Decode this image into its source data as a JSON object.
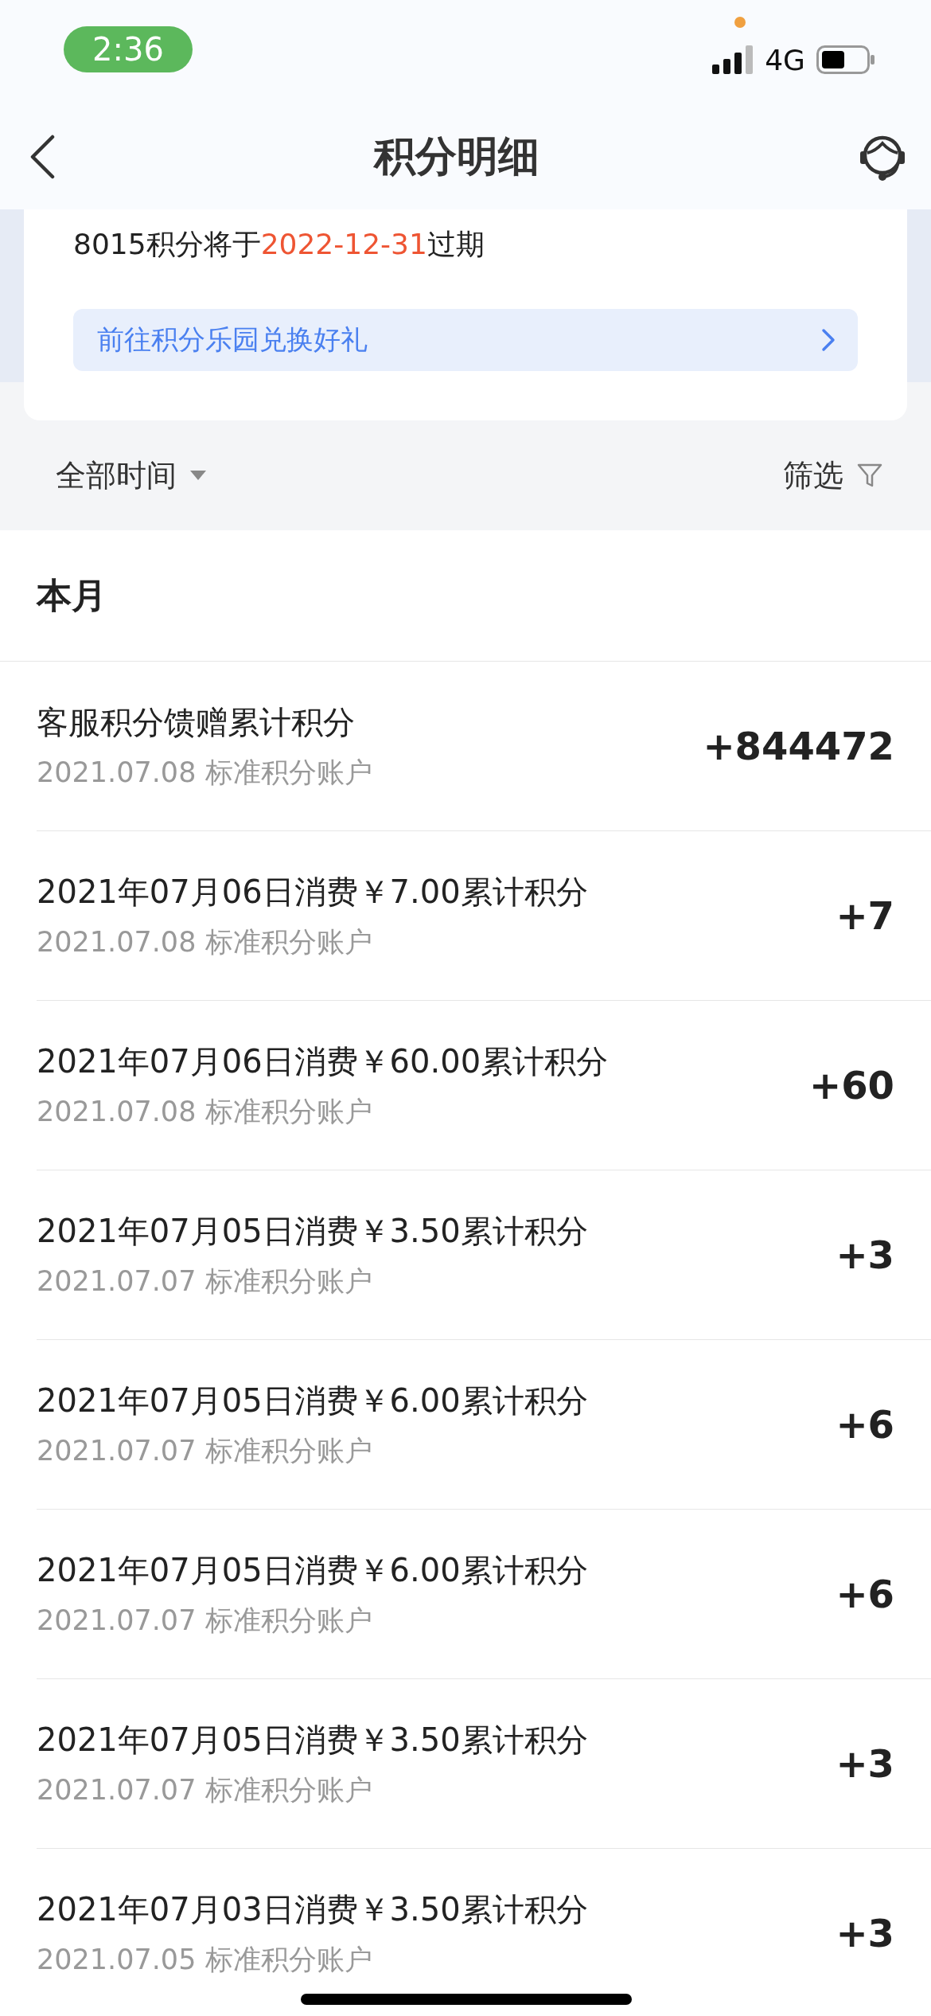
{
  "status_bar": {
    "time": "2:36",
    "network": "4G"
  },
  "nav": {
    "title": "积分明细"
  },
  "expiry": {
    "points": "8015积分将于",
    "date": "2022-12-31",
    "suffix": "过期"
  },
  "promo": {
    "label": "前往积分乐园兑换好礼"
  },
  "filters": {
    "period": "全部时间",
    "filter": "筛选"
  },
  "section": {
    "title": "本月"
  },
  "records": [
    {
      "title": "客服积分馈赠累计积分",
      "subtitle": "2021.07.08 标准积分账户",
      "amount": "+844472"
    },
    {
      "title": "2021年07月06日消费￥7.00累计积分",
      "subtitle": "2021.07.08 标准积分账户",
      "amount": "+7"
    },
    {
      "title": "2021年07月06日消费￥60.00累计积分",
      "subtitle": "2021.07.08 标准积分账户",
      "amount": "+60"
    },
    {
      "title": "2021年07月05日消费￥3.50累计积分",
      "subtitle": "2021.07.07 标准积分账户",
      "amount": "+3"
    },
    {
      "title": "2021年07月05日消费￥6.00累计积分",
      "subtitle": "2021.07.07 标准积分账户",
      "amount": "+6"
    },
    {
      "title": "2021年07月05日消费￥6.00累计积分",
      "subtitle": "2021.07.07 标准积分账户",
      "amount": "+6"
    },
    {
      "title": "2021年07月05日消费￥3.50累计积分",
      "subtitle": "2021.07.07 标准积分账户",
      "amount": "+3"
    },
    {
      "title": "2021年07月03日消费￥3.50累计积分",
      "subtitle": "2021.07.05 标准积分账户",
      "amount": "+3"
    }
  ]
}
